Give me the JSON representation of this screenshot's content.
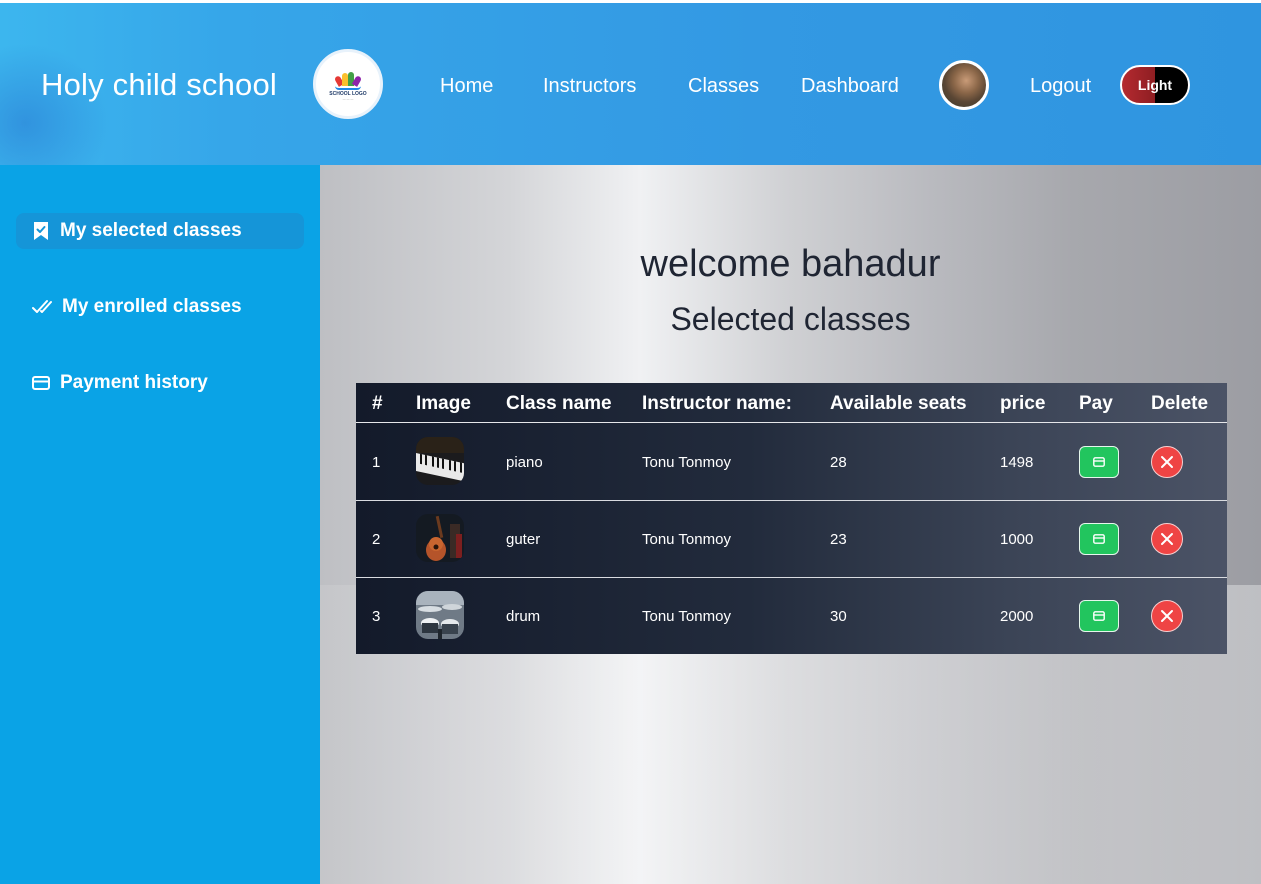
{
  "header": {
    "brand": "Holy child school",
    "logo_text": "SCHOOL LOGO",
    "nav": [
      {
        "label": "Home"
      },
      {
        "label": "Instructors"
      },
      {
        "label": "Classes"
      },
      {
        "label": "Dashboard"
      }
    ],
    "logout_label": "Logout",
    "theme_toggle_label": "Light"
  },
  "sidebar": {
    "items": [
      {
        "label": "My selected classes",
        "icon": "bookmark-check-icon",
        "active": true
      },
      {
        "label": "My enrolled classes",
        "icon": "double-check-icon",
        "active": false
      },
      {
        "label": "Payment history",
        "icon": "credit-card-icon",
        "active": false
      }
    ]
  },
  "main": {
    "welcome": "welcome bahadur",
    "subtitle": "Selected classes",
    "table": {
      "columns": [
        "#",
        "Image",
        "Class name",
        "Instructor name:",
        "Available seats",
        "price",
        "Pay",
        "Delete"
      ],
      "rows": [
        {
          "index": "1",
          "image": "piano-thumbnail",
          "class_name": "piano",
          "instructor": "Tonu Tonmoy",
          "seats": "28",
          "price": "1498"
        },
        {
          "index": "2",
          "image": "guitar-thumbnail",
          "class_name": "guter",
          "instructor": "Tonu Tonmoy",
          "seats": "23",
          "price": "1000"
        },
        {
          "index": "3",
          "image": "drum-thumbnail",
          "class_name": "drum",
          "instructor": "Tonu Tonmoy",
          "seats": "30",
          "price": "2000"
        }
      ]
    }
  },
  "colors": {
    "header_bg": "#3399e3",
    "sidebar_bg": "#0aa3e6",
    "pay_button": "#22c55e",
    "delete_button": "#ef4444",
    "table_bg": "#1f2737"
  }
}
